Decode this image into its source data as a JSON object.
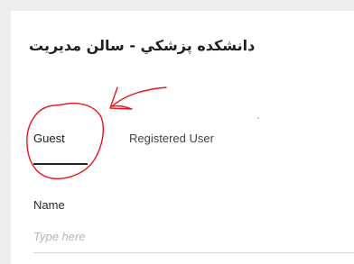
{
  "header": {
    "title": "دانشكده پزشكي - سالن مديريت"
  },
  "tabs": [
    {
      "label": "Guest",
      "selected": true
    },
    {
      "label": "Registered User",
      "selected": false
    }
  ],
  "form": {
    "name_label": "Name",
    "name_placeholder": "Type here",
    "name_value": ""
  },
  "annotation": {
    "color": "#e8141c",
    "shapes": [
      "circle-around-guest-tab",
      "arrow-pointing-to-guest-tab"
    ]
  },
  "colors": {
    "background": "#ededed",
    "card": "#ffffff",
    "active_underline": "#222222"
  }
}
